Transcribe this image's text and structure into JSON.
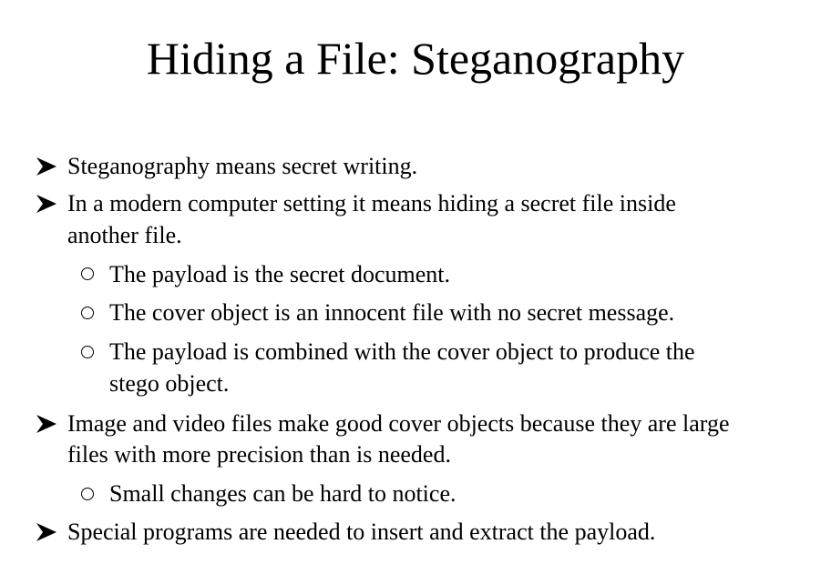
{
  "slide": {
    "title": "Hiding a File: Steganography",
    "bullets": [
      {
        "text": "Steganography means secret writing."
      },
      {
        "line1": "In a modern computer setting it means hiding a secret file inside",
        "line2": "another  file."
      },
      {
        "text": "The payload is the secret document."
      },
      {
        "text": "The cover object is an innocent file with no secret message."
      },
      {
        "line1": "The payload is combined with the cover object to produce the",
        "line2": "stego object."
      },
      {
        "line1": "Image and video files make good cover objects because they are large",
        "line2": "files with more precision than is needed."
      },
      {
        "text": "Small changes can be hard to notice."
      },
      {
        "text": "Special programs are needed to insert and extract the payload."
      }
    ]
  }
}
